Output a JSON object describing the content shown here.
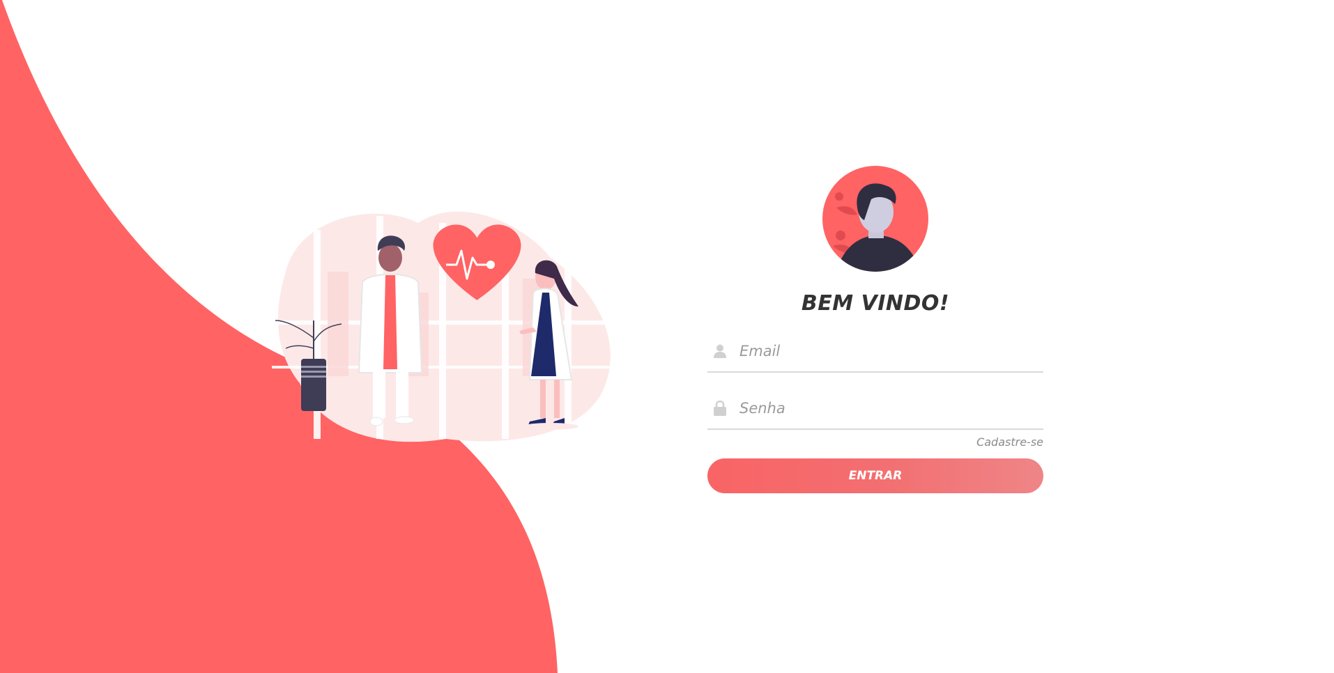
{
  "colors": {
    "accent": "#FF6363",
    "text_dark": "#333333",
    "text_muted": "#9A9A9A",
    "line": "#D9D9D9"
  },
  "login": {
    "title": "BEM VINDO!",
    "email_placeholder": "Email",
    "email_value": "",
    "email_icon": "user-icon",
    "password_placeholder": "Senha",
    "password_value": "",
    "password_icon": "lock-icon",
    "register_link": "Cadastre-se",
    "submit_label": "ENTRAR"
  }
}
